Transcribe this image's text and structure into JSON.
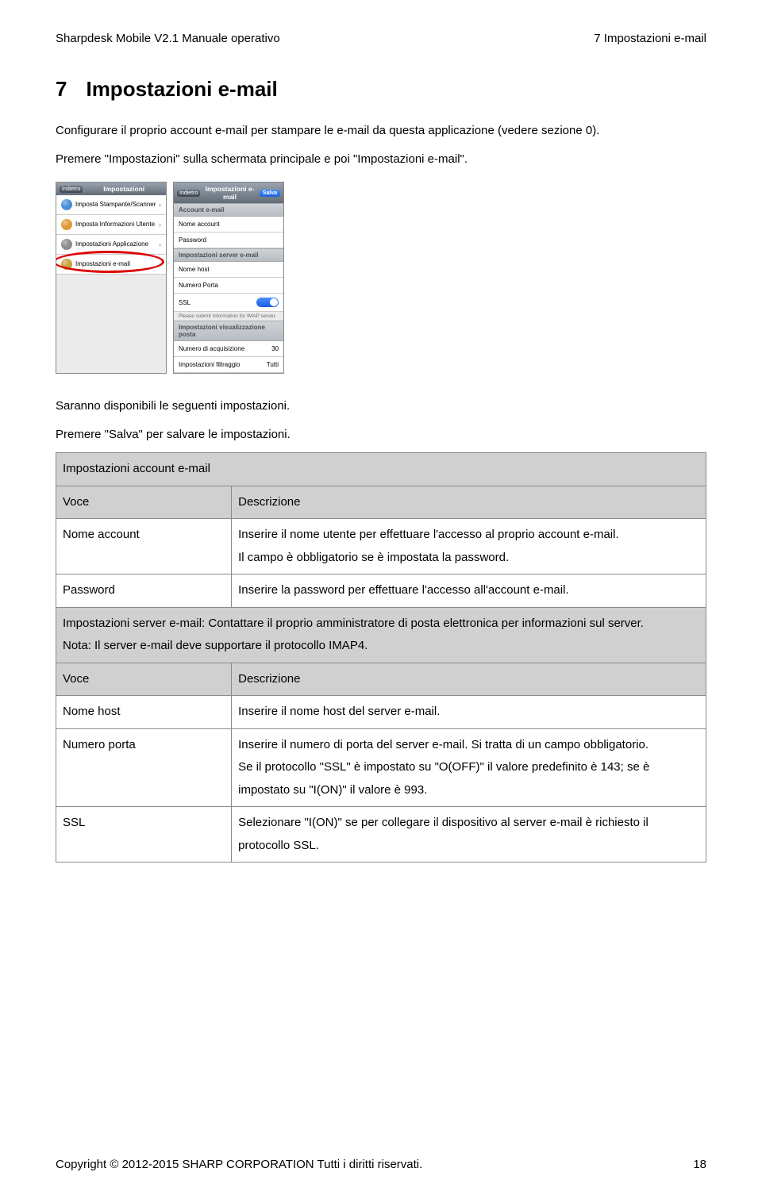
{
  "header": {
    "left": "Sharpdesk Mobile V2.1 Manuale operativo",
    "right": "7 Impostazioni e-mail"
  },
  "heading": {
    "num": "7",
    "title": "Impostazioni e-mail"
  },
  "intro": {
    "p1": "Configurare il proprio account e-mail per stampare le e-mail da questa applicazione (vedere sezione 0).",
    "p2": "Premere \"Impostazioni\" sulla schermata principale e poi \"Impostazioni e-mail\"."
  },
  "phone1": {
    "back": "Indietro",
    "title": "Impostazioni",
    "r1": "Imposta Stampante/Scanner",
    "r2": "Imposta Informazioni Utente",
    "r3": "Impostazioni Applicazione",
    "r4": "Impostazioni e-mail"
  },
  "phone2": {
    "back": "Indietro",
    "title": "Impostazioni e-mail",
    "save": "Salva",
    "s1": "Account e-mail",
    "r1": "Nome account",
    "r2": "Password",
    "s2": "Impostazioni server e-mail",
    "r3": "Nome host",
    "r4": "Numero Porta",
    "r5": "SSL",
    "note": "Please submit information for IMAP server.",
    "s3": "Impostazioni visualizzazione posta",
    "r6a": "Numero di acquisizione",
    "r6b": "30",
    "r7a": "Impostazioni filtraggio",
    "r7b": "Tutti"
  },
  "after": {
    "p1": "Saranno disponibili le seguenti impostazioni.",
    "p2": "Premere \"Salva\" per salvare le impostazioni."
  },
  "table": {
    "sec1": "Impostazioni account e-mail",
    "h_item": "Voce",
    "h_desc": "Descrizione",
    "r1a": "Nome account",
    "r1b_l1": "Inserire il nome utente per effettuare l'accesso al proprio account e-mail.",
    "r1b_l2": "Il campo è obbligatorio se è impostata la password.",
    "r2a": "Password",
    "r2b": "Inserire la password per effettuare l'accesso all'account e-mail.",
    "sec2_l1": "Impostazioni server e-mail: Contattare il proprio amministratore di posta elettronica per informazioni sul server.",
    "sec2_l2": "Nota: Il server e-mail deve supportare il protocollo IMAP4.",
    "r3a": "Nome host",
    "r3b": "Inserire il nome host del server e-mail.",
    "r4a": "Numero porta",
    "r4b_l1": "Inserire il numero di porta del server e-mail. Si tratta di un campo obbligatorio.",
    "r4b_l2": "Se il protocollo \"SSL\" è impostato su \"O(OFF)\" il valore predefinito è 143; se è impostato su \"I(ON)\" il valore è 993.",
    "r5a": "SSL",
    "r5b": "Selezionare \"I(ON)\" se per collegare il dispositivo al server e-mail è richiesto il protocollo SSL."
  },
  "footer": {
    "copyright": "Copyright © 2012-2015 SHARP CORPORATION Tutti i diritti riservati.",
    "page": "18"
  }
}
